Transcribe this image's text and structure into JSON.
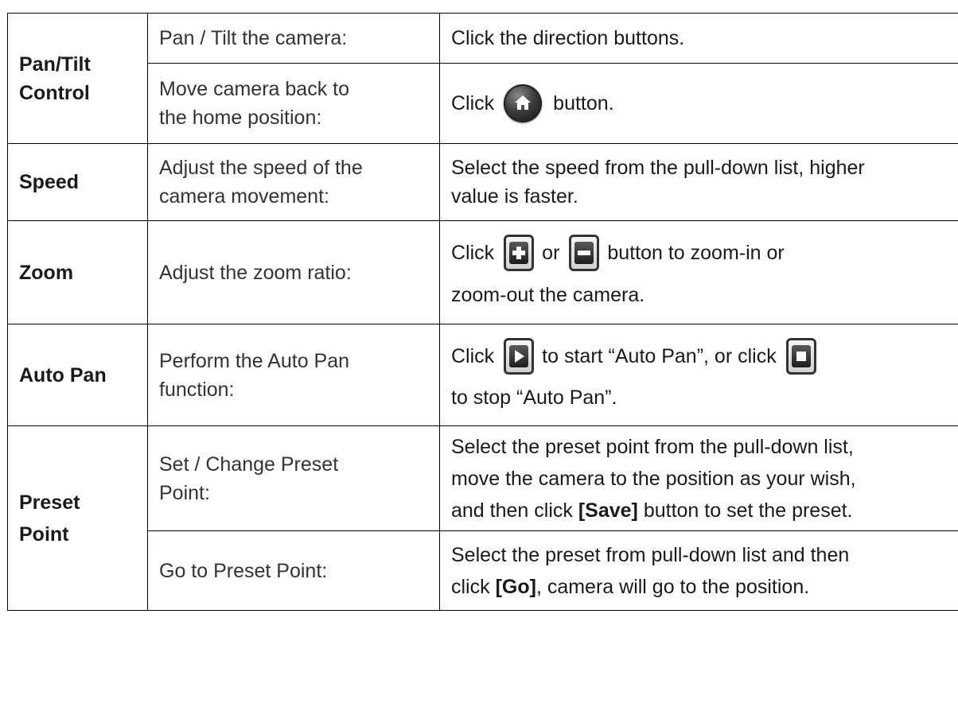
{
  "rows": {
    "pan_tilt": {
      "category_l1": "Pan/Tilt",
      "category_l2": "Control",
      "sub1": {
        "desc": "Pan / Tilt the camera:",
        "action": "Click the direction buttons."
      },
      "sub2": {
        "desc_l1": "Move camera back to",
        "desc_l2": "the home position:",
        "action_pre": "Click",
        "action_post": "button."
      }
    },
    "speed": {
      "category": "Speed",
      "desc_l1": "Adjust the speed of the",
      "desc_l2": "camera movement:",
      "action_l1": "Select the speed from the pull-down list, higher",
      "action_l2": "value is faster."
    },
    "zoom": {
      "category": "Zoom",
      "desc": "Adjust the zoom ratio:",
      "action_pre": "Click",
      "action_or": "or",
      "action_post": "button to zoom-in or",
      "action_l2": "zoom-out the camera."
    },
    "auto_pan": {
      "category": "Auto Pan",
      "desc_l1": "Perform the Auto Pan",
      "desc_l2": "function:",
      "action_pre": "Click",
      "action_mid": "to start “Auto Pan”, or click",
      "action_l2": "to stop “Auto Pan”."
    },
    "preset": {
      "category_l1": "Preset",
      "category_l2": "Point",
      "sub1": {
        "desc_l1": "Set / Change Preset",
        "desc_l2": "Point:",
        "action_l1": "Select the preset point from the pull-down list,",
        "action_l2": "move the camera to the position as your wish,",
        "action_l3_pre": "and then click ",
        "action_l3_bold": "[Save]",
        "action_l3_post": " button to set the preset."
      },
      "sub2": {
        "desc": "Go to Preset Point:",
        "action_l1": "Select the preset from pull-down list and then",
        "action_l2_pre": "click ",
        "action_l2_bold": "[Go]",
        "action_l2_post": ", camera will go to the position."
      }
    }
  },
  "icons": {
    "home": "home-icon",
    "zoom_in": "zoom-in-icon",
    "zoom_out": "zoom-out-icon",
    "play": "play-icon",
    "stop": "stop-icon"
  }
}
